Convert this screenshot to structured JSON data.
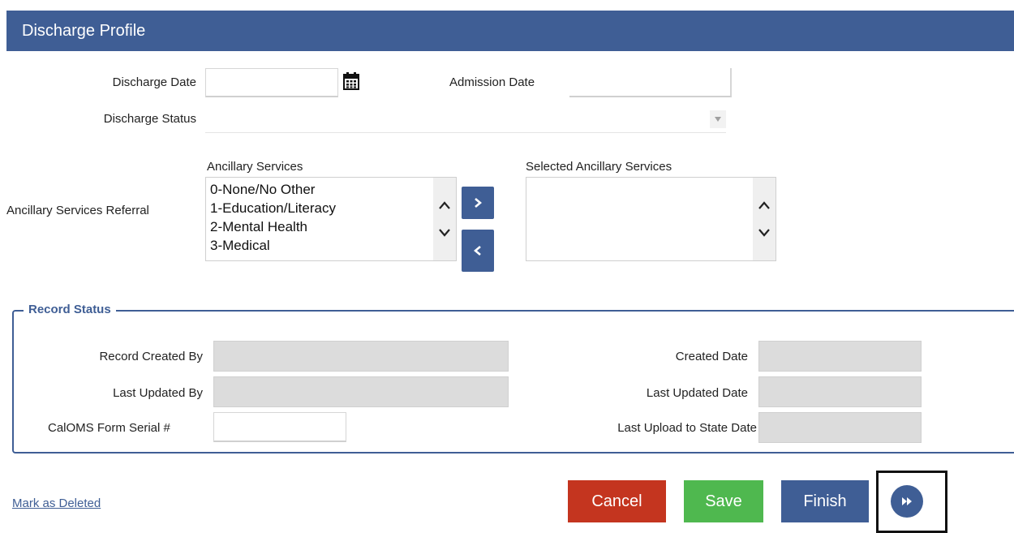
{
  "header": {
    "title": "Discharge Profile"
  },
  "discharge": {
    "discharge_date_label": "Discharge Date",
    "discharge_date_value": "",
    "admission_date_label": "Admission Date",
    "admission_date_value": "",
    "discharge_status_label": "Discharge Status",
    "discharge_status_value": ""
  },
  "ancillary": {
    "referral_label": "Ancillary Services Referral",
    "available_heading": "Ancillary Services",
    "selected_heading": "Selected Ancillary Services",
    "available_items": [
      "0-None/No Other",
      "1-Education/Literacy",
      "2-Mental Health",
      "3-Medical"
    ],
    "selected_items": []
  },
  "record_status": {
    "legend": "Record Status",
    "created_by_label": "Record Created By",
    "created_by_value": "",
    "last_updated_by_label": "Last Updated By",
    "last_updated_by_value": "",
    "calOMS_label": "CalOMS Form Serial #",
    "calOMS_value": "",
    "created_date_label": "Created Date",
    "created_date_value": "",
    "last_updated_date_label": "Last Updated Date",
    "last_updated_date_value": "",
    "last_upload_label": "Last Upload to State Date",
    "last_upload_value": ""
  },
  "actions": {
    "mark_deleted": "Mark as Deleted",
    "cancel": "Cancel",
    "save": "Save",
    "finish": "Finish"
  },
  "icons": {
    "calendar": "calendar-icon",
    "dropdown": "caret-down-icon",
    "move_right": "chevron-right-icon",
    "move_left": "chevron-left-icon",
    "scroll_up": "chevron-up-icon",
    "scroll_down": "chevron-down-icon",
    "next": "fast-forward-icon"
  },
  "colors": {
    "header": "#3f5e95",
    "primary": "#3f5e95",
    "cancel": "#c4351f",
    "save": "#4fb84f"
  }
}
